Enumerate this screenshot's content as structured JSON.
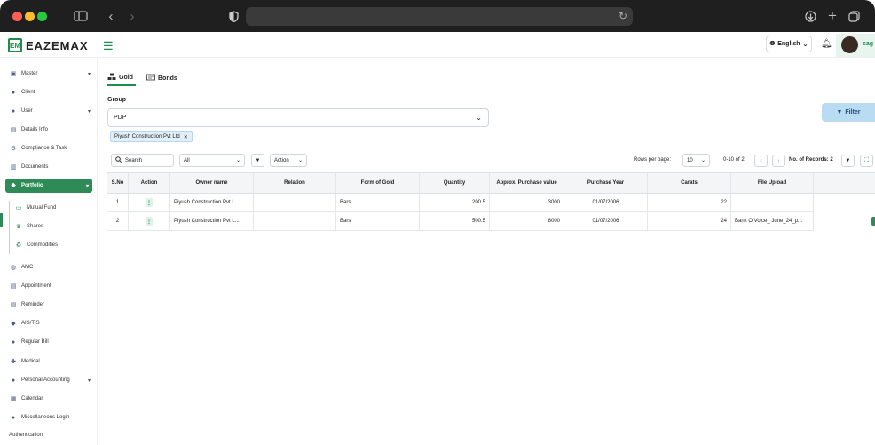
{
  "app": {
    "logo_mark": "EM",
    "logo_text": "EAZEMAX",
    "language": "English",
    "user_name": "sag"
  },
  "sidebar": {
    "items": [
      {
        "label": "Master",
        "icon": "building-icon",
        "has_arrow": true
      },
      {
        "label": "Client",
        "icon": "user-icon"
      },
      {
        "label": "User",
        "icon": "user-icon",
        "has_arrow": true
      },
      {
        "label": "Details Info",
        "icon": "file-icon"
      },
      {
        "label": "Compliance & Task",
        "icon": "tasks-icon"
      },
      {
        "label": "Documents",
        "icon": "folder-icon"
      },
      {
        "label": "Portfolio",
        "icon": "portfolio-icon",
        "has_arrow": true,
        "active": true
      },
      {
        "label": "Mutual Fund",
        "icon": "wallet-icon",
        "sub": true
      },
      {
        "label": "Shares",
        "icon": "trophy-icon",
        "sub": true
      },
      {
        "label": "Commodities",
        "icon": "recycle-icon",
        "sub": true
      },
      {
        "label": "AMC",
        "icon": "globe-icon"
      },
      {
        "label": "Appointment",
        "icon": "clipboard-icon"
      },
      {
        "label": "Reminder",
        "icon": "note-icon"
      },
      {
        "label": "AIS/TIS",
        "icon": "tag-icon"
      },
      {
        "label": "Regular Bill",
        "icon": "bill-icon"
      },
      {
        "label": "Medical",
        "icon": "medical-icon"
      },
      {
        "label": "Personal Accounting",
        "icon": "account-icon",
        "has_arrow": true
      },
      {
        "label": "Calendar",
        "icon": "calendar-icon"
      },
      {
        "label": "Miscellaneous Login",
        "icon": "login-icon"
      },
      {
        "label": "Authentication",
        "icon": ""
      }
    ]
  },
  "tabs": [
    {
      "label": "Gold",
      "icon": "gold-icon"
    },
    {
      "label": "Bonds",
      "icon": "bonds-icon"
    }
  ],
  "group": {
    "label": "Group",
    "selected": "PDP",
    "chip": "Piyush Construction Pvt Ltd",
    "filter_label": "Filter"
  },
  "toolbar": {
    "search_placeholder": "Search",
    "all_select": "All",
    "action_select": "Action",
    "rows_per_page_label": "Rows per page:",
    "rows_per_page": "10",
    "page_info": "0-10 of 2",
    "records_label": "No. of Records: 2"
  },
  "table": {
    "columns": [
      "S.No",
      "Action",
      "Owner name",
      "Relation",
      "Form of Gold",
      "Quantity",
      "Approx. Purchase value",
      "Purchase Year",
      "Carats",
      "File Upload"
    ],
    "rows": [
      {
        "sno": "1",
        "owner": "Piyush Construction Pvt L...",
        "relation": "",
        "form": "Bars",
        "quantity": "200.5",
        "value": "3000",
        "year": "01/07/2006",
        "carats": "22",
        "file": ""
      },
      {
        "sno": "2",
        "owner": "Piyush Construction Pvt L...",
        "relation": "",
        "form": "Bars",
        "quantity": "500.5",
        "value": "8000",
        "year": "01/07/2006",
        "carats": "24",
        "file": "Bank O Voice_ June_24_p..."
      }
    ]
  },
  "colors": {
    "accent": "#2e8b57",
    "filter_button": "#b9dcf3"
  }
}
